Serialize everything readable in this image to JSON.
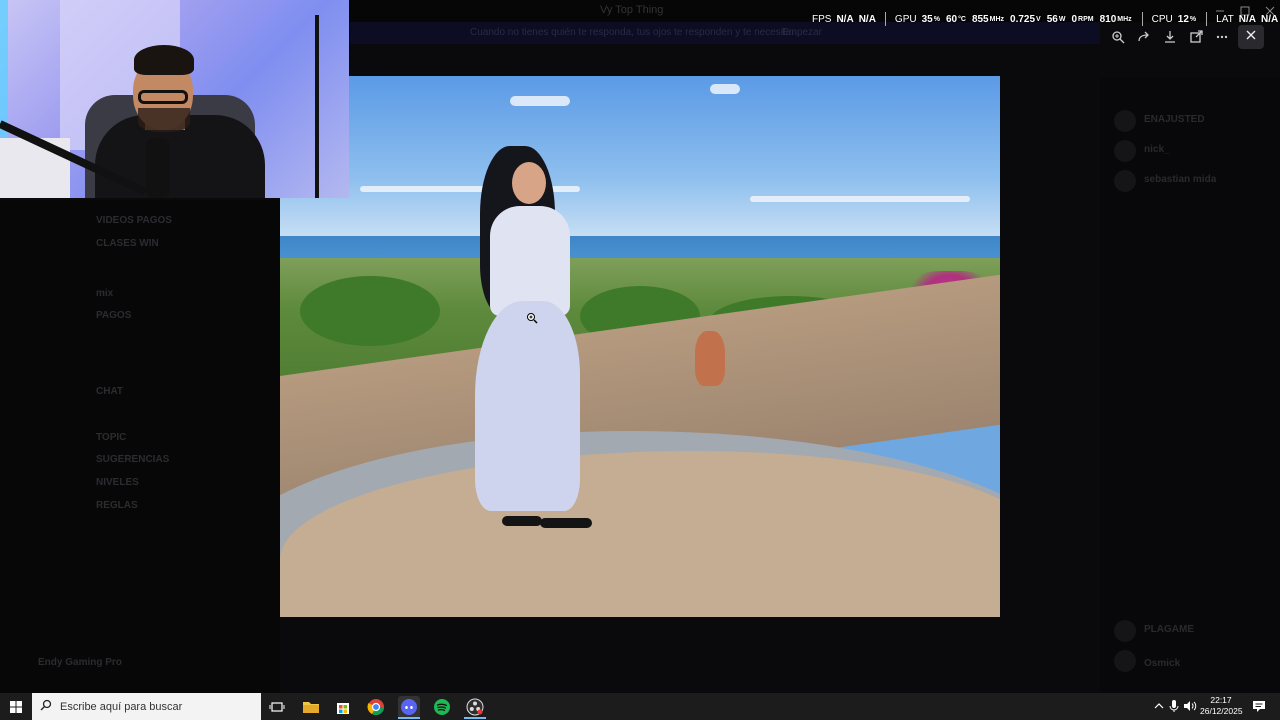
{
  "background_app": {
    "window_title": "Vy Top Thing",
    "banner_text": "Cuando no tienes quién te responda, tus ojos te responden y te necesitan",
    "banner_action": "Empezar",
    "channels": [
      "VIDEOS PAGOS",
      "CLASES WIN",
      "mix",
      "PAGOS",
      "CHAT",
      "TOPIC",
      "SUGERENCIAS",
      "NIVELES",
      "REGLAS"
    ],
    "members": [
      "ENAJUSTED",
      "nick_",
      "sebastian mida",
      "PLAGAME",
      "Osmick"
    ],
    "username": "Endy Gaming Pro"
  },
  "toolbar": {
    "icons": [
      "zoom-icon",
      "forward-icon",
      "download-icon",
      "open-external-icon",
      "more-icon"
    ],
    "close_icon": "close-icon"
  },
  "perf_overlay": {
    "fps_label": "FPS",
    "fps_value_1": "N/A",
    "fps_value_2": "N/A",
    "gpu_label": "GPU",
    "gpu_usage": "35",
    "gpu_usage_unit": "%",
    "gpu_temp": "60",
    "gpu_temp_unit": "°C",
    "gpu_clock": "855",
    "gpu_clock_unit": "MHz",
    "gpu_voltage": "0.725",
    "gpu_voltage_unit": "V",
    "gpu_power": "56",
    "gpu_power_unit": "W",
    "gpu_fan": "0",
    "gpu_fan_unit": "RPM",
    "gpu_mem_clock": "810",
    "gpu_mem_clock_unit": "MHz",
    "cpu_label": "CPU",
    "cpu_usage": "12",
    "cpu_usage_unit": "%",
    "lat_label": "LAT",
    "lat_value_1": "N/A",
    "lat_value_2": "N/A"
  },
  "taskbar": {
    "search_placeholder": "Escribe aquí para buscar",
    "time": "22:17",
    "date": "26/12/2025",
    "apps": [
      "task-view-icon",
      "file-explorer-icon",
      "store-icon",
      "chrome-icon",
      "discord-icon",
      "spotify-icon",
      "obs-icon"
    ]
  },
  "colors": {
    "taskbar": "#1c1c1c",
    "accent": "#76b9ed",
    "overlay_text": "#ffffff"
  }
}
